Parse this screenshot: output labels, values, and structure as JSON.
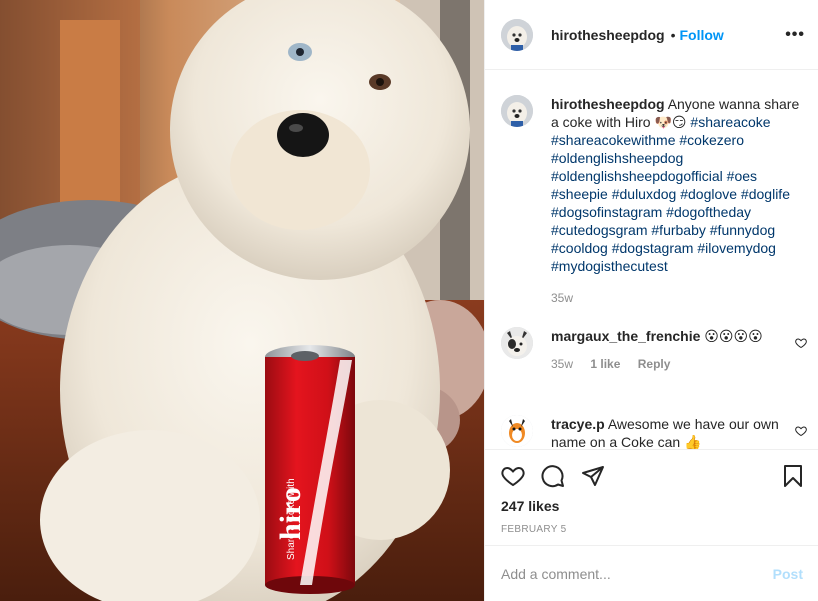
{
  "post": {
    "username": "hirothesheepdog",
    "follow_label": "Follow",
    "separator": "•",
    "more_label": "•••"
  },
  "photo": {
    "can_text": "hiro",
    "can_small_text": "Share a Coke with"
  },
  "caption": {
    "username": "hirothesheepdog",
    "text": "Anyone wanna share a coke with Hiro 🐶😏",
    "hashtags": "#shareacoke #shareacokewithme #cokezero #oldenglishsheepdog #oldenglishsheepdogofficial #oes #sheepie #duluxdog #doglove #doglife #dogsofinstagram #dogoftheday #cutedogsgram #furbaby #funnydog #cooldog #dogstagram #ilovemydog #mydogisthecutest",
    "time": "35w"
  },
  "comments": [
    {
      "username": "margaux_the_frenchie",
      "text": "😮😮😮😮",
      "time": "35w",
      "likes": "1 like",
      "reply_label": "Reply"
    },
    {
      "username": "tracye.p",
      "text": "Awesome we have our own name on a Coke can 👍"
    }
  ],
  "footer": {
    "likes": "247 likes",
    "date": "FEBRUARY 5",
    "comment_placeholder": "Add a comment...",
    "post_label": "Post"
  },
  "colors": {
    "accent": "#0095f6",
    "hashtag": "#00376b",
    "muted": "#8e8e8e",
    "post_disabled": "#b2dffc",
    "coke_red": "#e4141e"
  }
}
